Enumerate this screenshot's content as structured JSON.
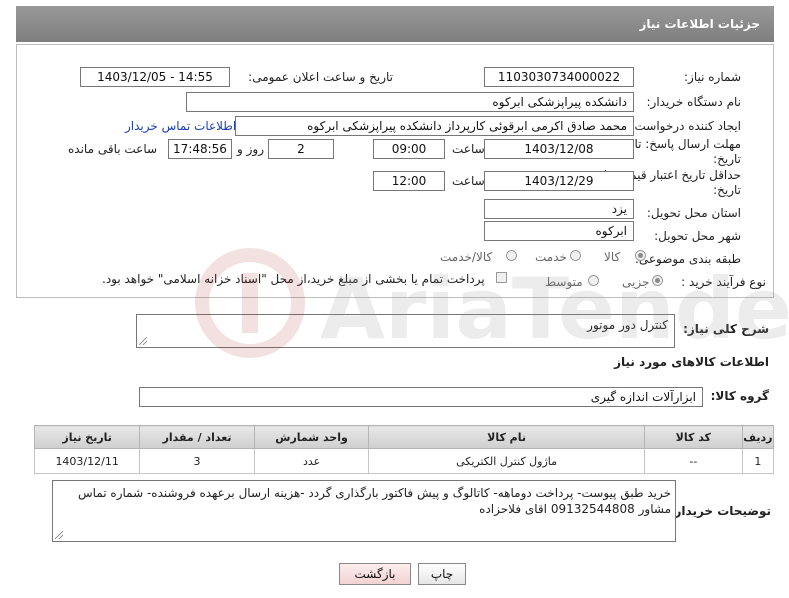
{
  "header": {
    "title": "جزئیات اطلاعات نیاز"
  },
  "form": {
    "need_number_label": "شماره نیاز:",
    "need_number": "1103030734000022",
    "announce_label": "تاریخ و ساعت اعلان عمومی:",
    "announce_value": "1403/12/05 - 14:55",
    "buyer_org_label": "نام دستگاه خریدار:",
    "buyer_org": "دانشکده پیراپزشکی ابرکوه",
    "creator_label": "ایجاد کننده درخواست:",
    "creator": "محمد صادق اکرمی ابرقوئی کارپرداز دانشکده پیراپزشکی ابرکوه",
    "contact_link": "اطلاعات تماس خریدار",
    "deadline_label_1": "مهلت ارسال پاسخ: تا",
    "deadline_label_2": "تاریخ:",
    "deadline_date": "1403/12/08",
    "time_label": "ساعت",
    "deadline_time": "09:00",
    "days_value": "2",
    "days_label": "روز و",
    "remaining_time": "17:48:56",
    "remaining_label": "ساعت باقی مانده",
    "validity_label_1": "حداقل تاریخ اعتبار قیمت: تا",
    "validity_label_2": "تاریخ:",
    "validity_date": "1403/12/29",
    "validity_time": "12:00",
    "province_label": "استان محل تحویل:",
    "province": "یزد",
    "city_label": "شهر محل تحویل:",
    "city": "ابرکوه",
    "category_label": "طبقه بندی موضوعی:",
    "category_options": [
      "کالا",
      "خدمت",
      "کالا/خدمت"
    ],
    "process_label": "نوع فرآیند خرید :",
    "process_options": [
      "جزیی",
      "متوسط"
    ],
    "payment_note": "پرداخت تمام یا بخشی از مبلغ خرید،از محل \"اسناد خزانه اسلامی\" خواهد بود."
  },
  "summary": {
    "label": "شرح کلی نیاز:",
    "value": "کنترل دور موتور"
  },
  "goods_section": {
    "title": "اطلاعات کالاهای مورد نیاز",
    "group_label": "گروه کالا:",
    "group_value": "ابزارآلات اندازه گیری"
  },
  "table": {
    "headers": [
      "ردیف",
      "کد کالا",
      "نام کالا",
      "واحد شمارش",
      "تعداد / مقدار",
      "تاریخ نیاز"
    ],
    "rows": [
      [
        "1",
        "--",
        "ماژول کنترل الکتریکی",
        "عدد",
        "3",
        "1403/12/11"
      ]
    ]
  },
  "buyer_notes": {
    "label": "توضیحات خریدار:",
    "text": "خرید طبق پیوست- پرداخت دوماهه- کاتالوگ و پیش فاکتور بارگذاری گردد -هزینه ارسال برعهده فروشنده- شماره تماس مشاور 09132544808 اقای فلاحزاده"
  },
  "buttons": {
    "print": "چاپ",
    "back": "بازگشت"
  },
  "watermark": {
    "text": "AriaTender.neT"
  },
  "colors": {
    "header": "#8c8c8c",
    "link": "#1a3fb8",
    "back_button": "#f7dede"
  }
}
